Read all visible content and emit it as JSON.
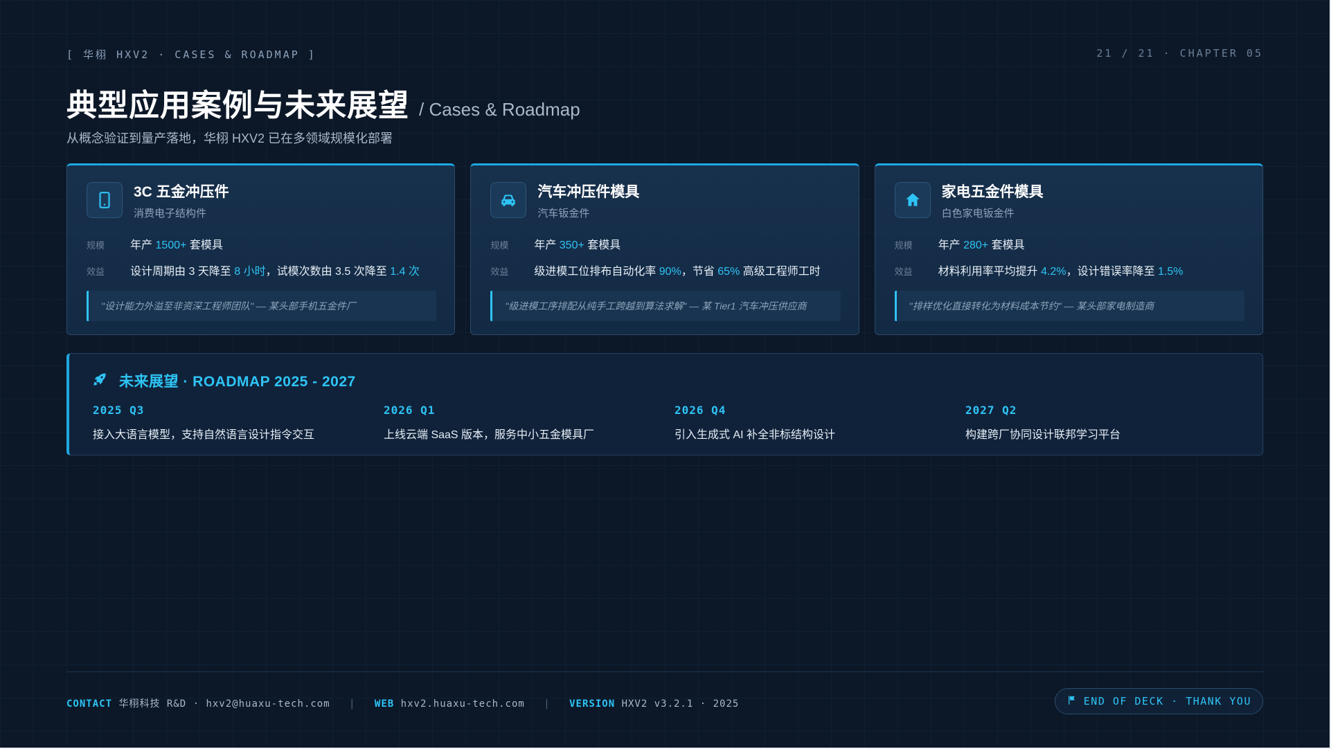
{
  "header": {
    "tag": "[ 华栩 HXV2 · CASES & ROADMAP ]",
    "page_indicator": "21 / 21 · CHAPTER 05",
    "title": "典型应用案例与未来展望",
    "title_en": "/ Cases & Roadmap",
    "subtitle": "从概念验证到量产落地，华栩 HXV2 已在多领域规模化部署"
  },
  "cards": [
    {
      "icon": "smartphone-icon",
      "title": "3C 五金冲压件",
      "subtitle": "消费电子结构件",
      "scale_label": "规模",
      "scale_pre": "年产 ",
      "scale_hl": "1500+",
      "scale_post": " 套模具",
      "benefit_label": "效益",
      "benefit_1": "设计周期由 3 天降至 ",
      "benefit_hl_1": "8 小时",
      "benefit_2": "，试模次数由 3.5 次降至 ",
      "benefit_hl_2": "1.4 次",
      "benefit_3": "",
      "quote": "\"设计能力外溢至非资深工程师团队\" — 某头部手机五金件厂"
    },
    {
      "icon": "car-icon",
      "title": "汽车冲压件模具",
      "subtitle": "汽车钣金件",
      "scale_label": "规模",
      "scale_pre": "年产 ",
      "scale_hl": "350+",
      "scale_post": " 套模具",
      "benefit_label": "效益",
      "benefit_1": "级进模工位排布自动化率 ",
      "benefit_hl_1": "90%",
      "benefit_2": "，节省 ",
      "benefit_hl_2": "65%",
      "benefit_3": " 高级工程师工时",
      "quote": "\"级进模工序排配从纯手工跨越到算法求解\" — 某 Tier1 汽车冲压供应商"
    },
    {
      "icon": "home-icon",
      "title": "家电五金件模具",
      "subtitle": "白色家电钣金件",
      "scale_label": "规模",
      "scale_pre": "年产 ",
      "scale_hl": "280+",
      "scale_post": " 套模具",
      "benefit_label": "效益",
      "benefit_1": "材料利用率平均提升 ",
      "benefit_hl_1": "4.2%",
      "benefit_2": "，设计错误率降至 ",
      "benefit_hl_2": "1.5%",
      "benefit_3": "",
      "quote": "\"排样优化直接转化为材料成本节约\" — 某头部家电制造商"
    }
  ],
  "roadmap": {
    "icon": "rocket-icon",
    "title": "未来展望 · ROADMAP 2025 - 2027",
    "items": [
      {
        "date": "2025 Q3",
        "text": "接入大语言模型，支持自然语言设计指令交互"
      },
      {
        "date": "2026 Q1",
        "text": "上线云端 SaaS 版本，服务中小五金模具厂"
      },
      {
        "date": "2026 Q4",
        "text": "引入生成式 AI 补全非标结构设计"
      },
      {
        "date": "2027 Q2",
        "text": "构建跨厂协同设计联邦学习平台"
      }
    ]
  },
  "footer": {
    "contact_label": "CONTACT",
    "contact_value": "华栩科技 R&D · hxv2@huaxu-tech.com",
    "separator": "|",
    "web_label": "WEB",
    "web_value": "hxv2.huaxu-tech.com",
    "version_label": "VERSION",
    "version_value": "HXV2 v3.2.1 · 2025",
    "end_icon": "flag-icon",
    "end_label": "END OF DECK · THANK YOU"
  },
  "colors": {
    "background": "#0c1828",
    "accent": "#2ec4f5",
    "card_border": "#1ea8e0"
  }
}
